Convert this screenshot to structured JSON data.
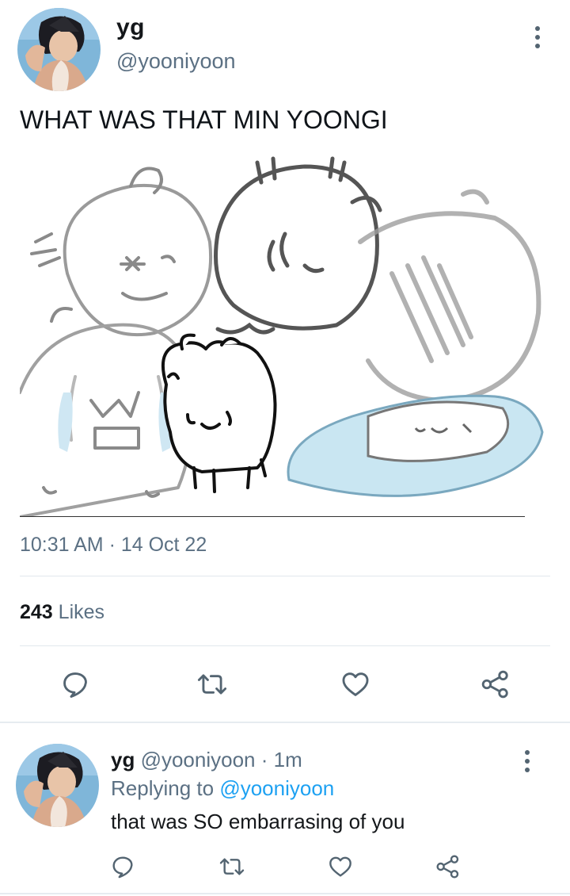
{
  "tweet": {
    "display_name": "yg",
    "handle": "@yooniyoon",
    "text": "WHAT WAS THAT MIN YOONGI",
    "timestamp": "10:31 AM · 14 Oct 22",
    "likes_count": "243",
    "likes_label": "Likes"
  },
  "reply": {
    "display_name": "yg",
    "meta": "@yooniyoon · 1m",
    "replying_prefix": "Replying to",
    "replying_to": "@yooniyoon",
    "text": "that was SO embarrasing of you"
  },
  "icons": {
    "reply": "reply-icon",
    "retweet": "retweet-icon",
    "like": "heart-icon",
    "share": "share-icon",
    "more": "more-vertical-icon"
  },
  "colors": {
    "secondary_text": "#5b7083",
    "link": "#1da1f2",
    "icon": "#536471"
  }
}
